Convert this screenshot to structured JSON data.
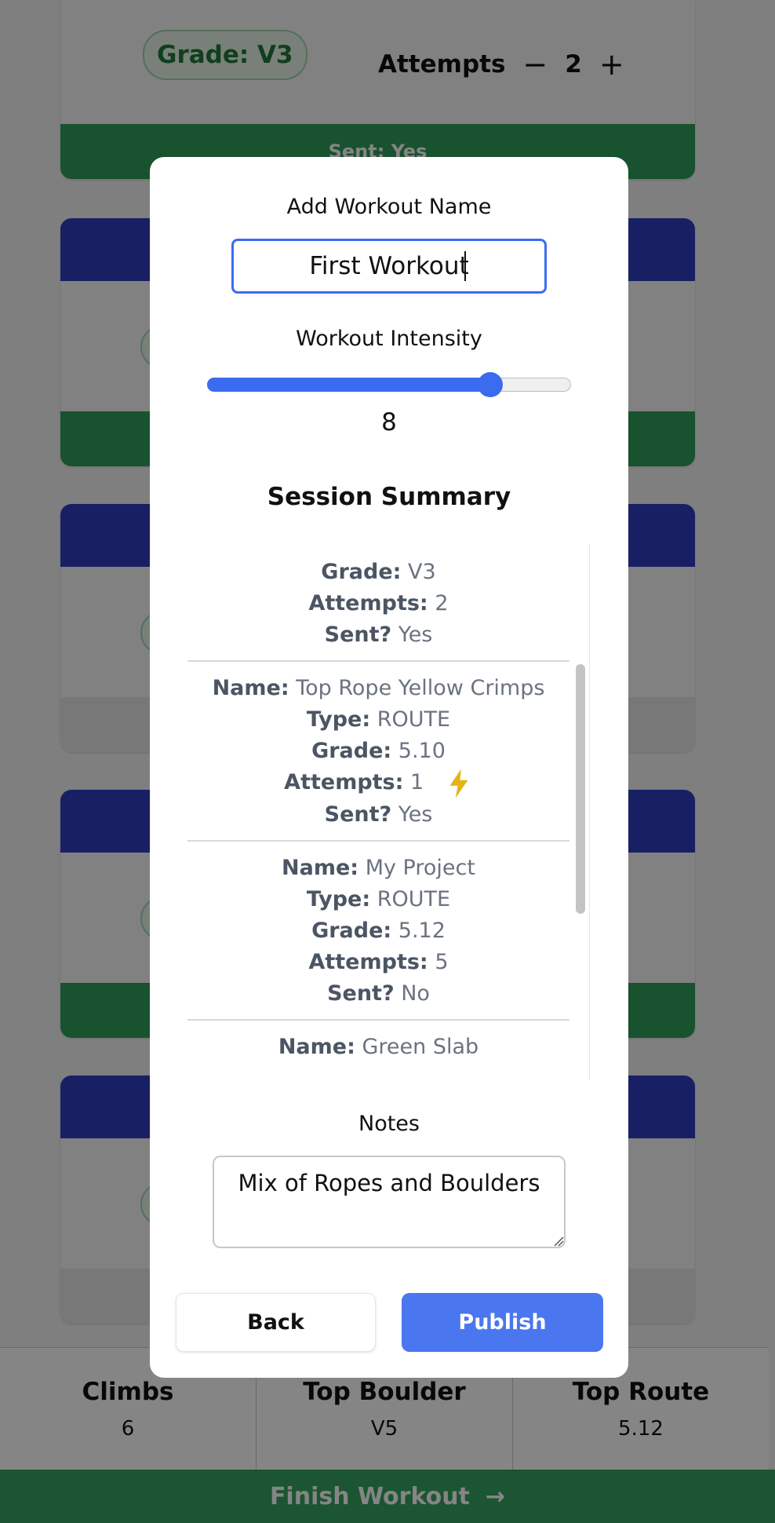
{
  "background": {
    "first_card": {
      "grade": "Grade: V3",
      "attempts_label": "Attempts",
      "attempts_value": "2",
      "minus": "−",
      "plus": "+",
      "sent": "Sent: Yes"
    },
    "stats": [
      {
        "label": "Climbs",
        "value": "6"
      },
      {
        "label": "Top Boulder",
        "value": "V5"
      },
      {
        "label": "Top Route",
        "value": "5.12"
      }
    ],
    "finish_label": "Finish Workout",
    "finish_arrow": "→"
  },
  "modal": {
    "name_label": "Add Workout Name",
    "name_value": "First Workout",
    "intensity_label": "Workout Intensity",
    "intensity_value": "8",
    "intensity_fraction": 0.8,
    "summary_title": "Session Summary",
    "entries": [
      {
        "grade": "V3",
        "attempts": "2",
        "sent": "Yes"
      },
      {
        "name": "Top Rope Yellow Crimps",
        "type": "ROUTE",
        "grade": "5.10",
        "attempts": "1",
        "sent": "Yes",
        "flash_icon": "lightning-icon"
      },
      {
        "name": "My Project",
        "type": "ROUTE",
        "grade": "5.12",
        "attempts": "5",
        "sent": "No"
      },
      {
        "name": "Green Slab"
      }
    ],
    "labels": {
      "name": "Name:",
      "type": "Type:",
      "grade": "Grade:",
      "attempts": "Attempts:",
      "sent": "Sent?"
    },
    "notes_label": "Notes",
    "notes_value": "Mix of Ropes and Boulders",
    "back_label": "Back",
    "publish_label": "Publish"
  },
  "colors": {
    "primary": "#4a76f0",
    "card_header": "#2f3fbf",
    "sent_green": "#2f9e5a",
    "flash": "#e5b413"
  }
}
